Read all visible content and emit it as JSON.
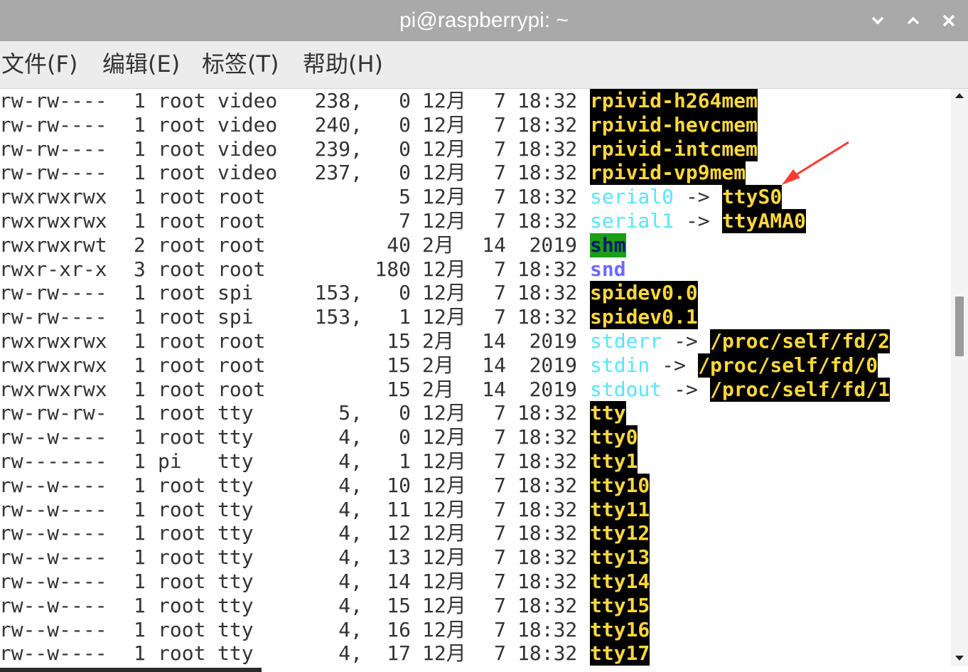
{
  "window": {
    "title": "pi@raspberrypi: ~",
    "controls": {
      "minimize": "chevron-down-icon",
      "maximize": "chevron-up-icon",
      "close": "close-icon"
    }
  },
  "menu": [
    "文件(F)",
    "编辑(E)",
    "标签(T)",
    "帮助(H)"
  ],
  "colors": {
    "titlebar": "#a9a9a9",
    "highlight_bg": "#000000",
    "highlight_fg": "#ffd83a",
    "symlink": "#55e6ff",
    "directory": "#6a6aff",
    "sticky_dir_bg": "#1a9e16",
    "annotation_arrow": "#ff3b30"
  },
  "listing": [
    {
      "perm": "crw-rw----",
      "links": "1",
      "owner": "root",
      "group": "video",
      "size": "238,",
      "minor": "0",
      "month": "12月",
      "day": "7",
      "time": "18:32",
      "name": "rpivid-h264mem",
      "type": "dev",
      "target": ""
    },
    {
      "perm": "crw-rw----",
      "links": "1",
      "owner": "root",
      "group": "video",
      "size": "240,",
      "minor": "0",
      "month": "12月",
      "day": "7",
      "time": "18:32",
      "name": "rpivid-hevcmem",
      "type": "dev",
      "target": ""
    },
    {
      "perm": "crw-rw----",
      "links": "1",
      "owner": "root",
      "group": "video",
      "size": "239,",
      "minor": "0",
      "month": "12月",
      "day": "7",
      "time": "18:32",
      "name": "rpivid-intcmem",
      "type": "dev",
      "target": ""
    },
    {
      "perm": "crw-rw----",
      "links": "1",
      "owner": "root",
      "group": "video",
      "size": "237,",
      "minor": "0",
      "month": "12月",
      "day": "7",
      "time": "18:32",
      "name": "rpivid-vp9mem",
      "type": "dev",
      "target": ""
    },
    {
      "perm": "lrwxrwxrwx",
      "links": "1",
      "owner": "root",
      "group": "root",
      "size": "",
      "minor": "5",
      "month": "12月",
      "day": "7",
      "time": "18:32",
      "name": "serial0",
      "type": "link",
      "target": "ttyS0"
    },
    {
      "perm": "lrwxrwxrwx",
      "links": "1",
      "owner": "root",
      "group": "root",
      "size": "",
      "minor": "7",
      "month": "12月",
      "day": "7",
      "time": "18:32",
      "name": "serial1",
      "type": "link",
      "target": "ttyAMA0"
    },
    {
      "perm": "drwxrwxrwt",
      "links": "2",
      "owner": "root",
      "group": "root",
      "size": "",
      "minor": "40",
      "month": "2月",
      "day": "14",
      "time": "2019",
      "name": "shm",
      "type": "sticky",
      "target": ""
    },
    {
      "perm": "drwxr-xr-x",
      "links": "3",
      "owner": "root",
      "group": "root",
      "size": "",
      "minor": "180",
      "month": "12月",
      "day": "7",
      "time": "18:32",
      "name": "snd",
      "type": "dir",
      "target": ""
    },
    {
      "perm": "crw-rw----",
      "links": "1",
      "owner": "root",
      "group": "spi",
      "size": "153,",
      "minor": "0",
      "month": "12月",
      "day": "7",
      "time": "18:32",
      "name": "spidev0.0",
      "type": "dev",
      "target": ""
    },
    {
      "perm": "crw-rw----",
      "links": "1",
      "owner": "root",
      "group": "spi",
      "size": "153,",
      "minor": "1",
      "month": "12月",
      "day": "7",
      "time": "18:32",
      "name": "spidev0.1",
      "type": "dev",
      "target": ""
    },
    {
      "perm": "lrwxrwxrwx",
      "links": "1",
      "owner": "root",
      "group": "root",
      "size": "",
      "minor": "15",
      "month": "2月",
      "day": "14",
      "time": "2019",
      "name": "stderr",
      "type": "link",
      "target": "/proc/self/fd/2"
    },
    {
      "perm": "lrwxrwxrwx",
      "links": "1",
      "owner": "root",
      "group": "root",
      "size": "",
      "minor": "15",
      "month": "2月",
      "day": "14",
      "time": "2019",
      "name": "stdin",
      "type": "link",
      "target": "/proc/self/fd/0"
    },
    {
      "perm": "lrwxrwxrwx",
      "links": "1",
      "owner": "root",
      "group": "root",
      "size": "",
      "minor": "15",
      "month": "2月",
      "day": "14",
      "time": "2019",
      "name": "stdout",
      "type": "link",
      "target": "/proc/self/fd/1"
    },
    {
      "perm": "crw-rw-rw-",
      "links": "1",
      "owner": "root",
      "group": "tty",
      "size": "5,",
      "minor": "0",
      "month": "12月",
      "day": "7",
      "time": "18:32",
      "name": "tty",
      "type": "dev",
      "target": ""
    },
    {
      "perm": "crw--w----",
      "links": "1",
      "owner": "root",
      "group": "tty",
      "size": "4,",
      "minor": "0",
      "month": "12月",
      "day": "7",
      "time": "18:32",
      "name": "tty0",
      "type": "dev",
      "target": ""
    },
    {
      "perm": "crw-------",
      "links": "1",
      "owner": "pi",
      "group": "tty",
      "size": "4,",
      "minor": "1",
      "month": "12月",
      "day": "7",
      "time": "18:32",
      "name": "tty1",
      "type": "dev",
      "target": ""
    },
    {
      "perm": "crw--w----",
      "links": "1",
      "owner": "root",
      "group": "tty",
      "size": "4,",
      "minor": "10",
      "month": "12月",
      "day": "7",
      "time": "18:32",
      "name": "tty10",
      "type": "dev",
      "target": ""
    },
    {
      "perm": "crw--w----",
      "links": "1",
      "owner": "root",
      "group": "tty",
      "size": "4,",
      "minor": "11",
      "month": "12月",
      "day": "7",
      "time": "18:32",
      "name": "tty11",
      "type": "dev",
      "target": ""
    },
    {
      "perm": "crw--w----",
      "links": "1",
      "owner": "root",
      "group": "tty",
      "size": "4,",
      "minor": "12",
      "month": "12月",
      "day": "7",
      "time": "18:32",
      "name": "tty12",
      "type": "dev",
      "target": ""
    },
    {
      "perm": "crw--w----",
      "links": "1",
      "owner": "root",
      "group": "tty",
      "size": "4,",
      "minor": "13",
      "month": "12月",
      "day": "7",
      "time": "18:32",
      "name": "tty13",
      "type": "dev",
      "target": ""
    },
    {
      "perm": "crw--w----",
      "links": "1",
      "owner": "root",
      "group": "tty",
      "size": "4,",
      "minor": "14",
      "month": "12月",
      "day": "7",
      "time": "18:32",
      "name": "tty14",
      "type": "dev",
      "target": ""
    },
    {
      "perm": "crw--w----",
      "links": "1",
      "owner": "root",
      "group": "tty",
      "size": "4,",
      "minor": "15",
      "month": "12月",
      "day": "7",
      "time": "18:32",
      "name": "tty15",
      "type": "dev",
      "target": ""
    },
    {
      "perm": "crw--w----",
      "links": "1",
      "owner": "root",
      "group": "tty",
      "size": "4,",
      "minor": "16",
      "month": "12月",
      "day": "7",
      "time": "18:32",
      "name": "tty16",
      "type": "dev",
      "target": ""
    },
    {
      "perm": "crw--w----",
      "links": "1",
      "owner": "root",
      "group": "tty",
      "size": "4,",
      "minor": "17",
      "month": "12月",
      "day": "7",
      "time": "18:32",
      "name": "tty17",
      "type": "dev",
      "target": ""
    }
  ],
  "arrow_symbol": "->"
}
